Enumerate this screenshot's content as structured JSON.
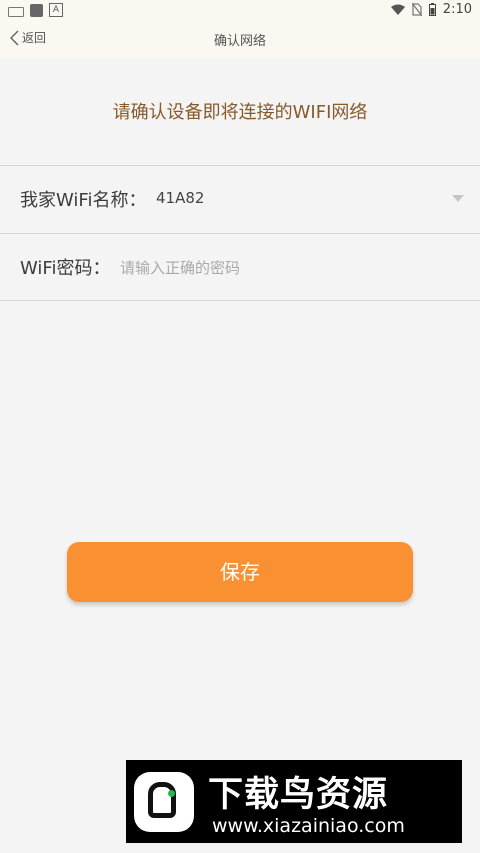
{
  "status_bar": {
    "time": "2:10",
    "left_icons": [
      "keyboard-icon",
      "notification-square-icon",
      "a-icon"
    ],
    "right_icons": [
      "wifi-icon",
      "no-sim-icon",
      "battery-icon"
    ]
  },
  "header": {
    "back_label": "返回",
    "title": "确认网络"
  },
  "instruction": "请确认设备即将连接的WIFI网络",
  "form": {
    "ssid_label": "我家WiFi名称：",
    "ssid_value": "41A82",
    "password_label": "WiFi密码：",
    "password_placeholder": "请输入正确的密码",
    "password_value": ""
  },
  "save_label": "保存",
  "watermark": {
    "title": "下载鸟资源",
    "url": "www.xiazainiao.com"
  },
  "colors": {
    "accent": "#f99132",
    "instruction_text": "#875a2a",
    "header_bg": "#fbf8f1",
    "page_bg": "#f5f4f4"
  }
}
